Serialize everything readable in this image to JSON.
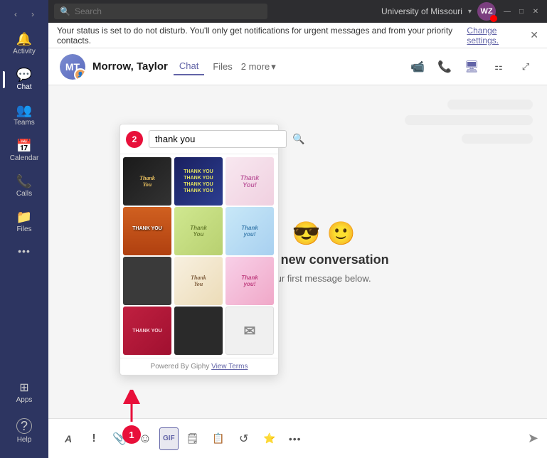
{
  "sidebar": {
    "nav_back": "‹",
    "nav_forward": "›",
    "items": [
      {
        "id": "activity",
        "label": "Activity",
        "icon": "🔔",
        "active": false
      },
      {
        "id": "chat",
        "label": "Chat",
        "icon": "💬",
        "active": true
      },
      {
        "id": "teams",
        "label": "Teams",
        "icon": "👥",
        "active": false
      },
      {
        "id": "calendar",
        "label": "Calendar",
        "icon": "📅",
        "active": false
      },
      {
        "id": "calls",
        "label": "Calls",
        "icon": "📞",
        "active": false
      },
      {
        "id": "files",
        "label": "Files",
        "icon": "📁",
        "active": false
      },
      {
        "id": "more",
        "label": "...",
        "icon": "···",
        "active": false
      }
    ],
    "bottom_items": [
      {
        "id": "apps",
        "label": "Apps",
        "icon": "⊞"
      },
      {
        "id": "help",
        "label": "Help",
        "icon": "?"
      }
    ]
  },
  "titlebar": {
    "search_placeholder": "Search",
    "tenant": "University of Missouri",
    "tenant_chevron": "▾",
    "avatar_initials": "WZ",
    "minimize": "—",
    "maximize": "□",
    "close": "✕"
  },
  "notification": {
    "message": "Your status is set to do not disturb. You'll only get notifications for urgent messages and from your priority contacts.",
    "change_link": "Change settings.",
    "close": "✕"
  },
  "contact_header": {
    "name": "Morrow, Taylor",
    "tabs": [
      {
        "label": "Chat",
        "active": true
      },
      {
        "label": "Files",
        "active": false
      }
    ],
    "more_label": "2 more",
    "more_chevron": "▾"
  },
  "chat_center": {
    "emoji": "😎 🙂",
    "title": "g a new conversation",
    "subtitle": "ur first message below."
  },
  "gif_panel": {
    "step": "2",
    "search_value": "thank you",
    "search_placeholder": "thank you",
    "gifs": [
      {
        "id": 1,
        "label": "Thank You",
        "class": "gif-1"
      },
      {
        "id": 2,
        "label": "THANK YOU\nTHANK YOU\nTHANK YOU\nTHANK YOU",
        "class": "gif-2"
      },
      {
        "id": 3,
        "label": "Thank\nYou!",
        "class": "gif-3"
      },
      {
        "id": 4,
        "label": "THANK YOU",
        "class": "gif-4"
      },
      {
        "id": 5,
        "label": "Thank\nYou",
        "class": "gif-5"
      },
      {
        "id": 6,
        "label": "Thank\nyou!",
        "class": "gif-6"
      },
      {
        "id": 7,
        "label": "",
        "class": "gif-7"
      },
      {
        "id": 8,
        "label": "Thank\nYou",
        "class": "gif-8"
      },
      {
        "id": 9,
        "label": "Thank you!",
        "class": "gif-9"
      },
      {
        "id": 10,
        "label": "THANK YOU",
        "class": "gif-10"
      },
      {
        "id": 11,
        "label": "",
        "class": "gif-11"
      },
      {
        "id": 12,
        "label": "✉",
        "class": "gif-12"
      }
    ],
    "footer_text": "Powered By Giphy",
    "footer_link": "View Terms"
  },
  "toolbar": {
    "buttons": [
      {
        "id": "format",
        "icon": "A",
        "label": "Format"
      },
      {
        "id": "exclaim",
        "icon": "!",
        "label": "Urgent"
      },
      {
        "id": "attach",
        "icon": "📎",
        "label": "Attach"
      },
      {
        "id": "emoji",
        "icon": "☺",
        "label": "Emoji"
      },
      {
        "id": "gif",
        "icon": "GIF",
        "label": "GIF"
      },
      {
        "id": "sticker",
        "icon": "🗒",
        "label": "Sticker"
      },
      {
        "id": "schedule",
        "icon": "📅",
        "label": "Schedule"
      },
      {
        "id": "loop",
        "icon": "↺",
        "label": "Loop"
      },
      {
        "id": "praise",
        "icon": "⭐",
        "label": "Praise"
      },
      {
        "id": "more",
        "icon": "···",
        "label": "More"
      }
    ],
    "send_icon": "➤"
  },
  "annotations": {
    "arrow_label": "1"
  }
}
